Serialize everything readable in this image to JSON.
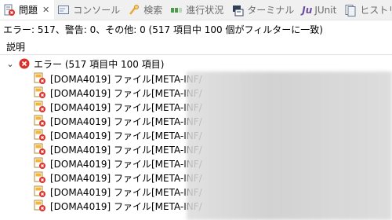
{
  "tabs": [
    {
      "label": "問題",
      "icon": "problems-icon",
      "active": true,
      "close": "✕"
    },
    {
      "label": "コンソール",
      "icon": "console-icon"
    },
    {
      "label": "検索",
      "icon": "search-icon"
    },
    {
      "label": "進行状況",
      "icon": "progress-icon"
    },
    {
      "label": "ターミナル",
      "icon": "terminal-icon"
    },
    {
      "label": "JUnit",
      "icon": "junit-icon",
      "prefix": "Ju"
    },
    {
      "label": "ヒストリー",
      "icon": "history-icon"
    }
  ],
  "summary": "エラー: 517、警告: 0、その他: 0 (517 項目中 100 個がフィルターに一致)",
  "column_header": "説明",
  "group": {
    "label": "エラー (517 項目中 100 項目)",
    "expanded": true
  },
  "rows": [
    "[DOMA4019] ファイル[META-INF/",
    "[DOMA4019] ファイル[META-INF/",
    "[DOMA4019] ファイル[META-INF/",
    "[DOMA4019] ファイル[META-INF/",
    "[DOMA4019] ファイル[META-INF/",
    "[DOMA4019] ファイル[META-INF/",
    "[DOMA4019] ファイル[META-INF/",
    "[DOMA4019] ファイル[META-INF/",
    "[DOMA4019] ファイル[META-INF/",
    "[DOMA4019] ファイル[META-INF/"
  ],
  "colors": {
    "error": "#d9302b",
    "warn_badge": "#f2b632",
    "junit": "#6b4d9c"
  }
}
